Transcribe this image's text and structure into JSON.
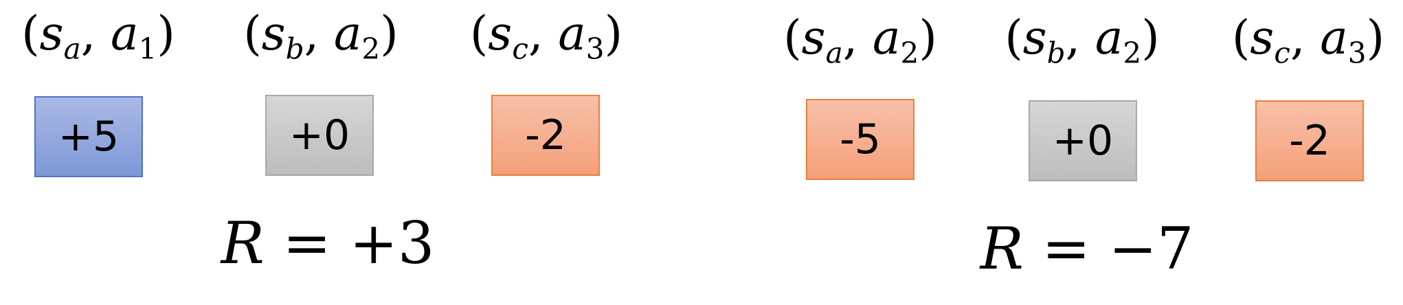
{
  "left": {
    "pairs": [
      {
        "s": "s",
        "s_sub": "a",
        "a": "a",
        "a_sub": "1",
        "reward": "+5",
        "kind": "pos"
      },
      {
        "s": "s",
        "s_sub": "b",
        "a": "a",
        "a_sub": "2",
        "reward": "+0",
        "kind": "zero"
      },
      {
        "s": "s",
        "s_sub": "c",
        "a": "a",
        "a_sub": "3",
        "reward": "-2",
        "kind": "neg"
      }
    ],
    "total_symbol": "R",
    "total_eq": "=",
    "total_value": "+3"
  },
  "right": {
    "pairs": [
      {
        "s": "s",
        "s_sub": "a",
        "a": "a",
        "a_sub": "2",
        "reward": "-5",
        "kind": "neg"
      },
      {
        "s": "s",
        "s_sub": "b",
        "a": "a",
        "a_sub": "2",
        "reward": "+0",
        "kind": "zero"
      },
      {
        "s": "s",
        "s_sub": "c",
        "a": "a",
        "a_sub": "3",
        "reward": "-2",
        "kind": "neg"
      }
    ],
    "total_symbol": "R",
    "total_eq": "=",
    "total_value": "−7"
  },
  "colors": {
    "positive": "#7d98d6",
    "zero": "#bdbdbd",
    "negative": "#f4a07a"
  }
}
